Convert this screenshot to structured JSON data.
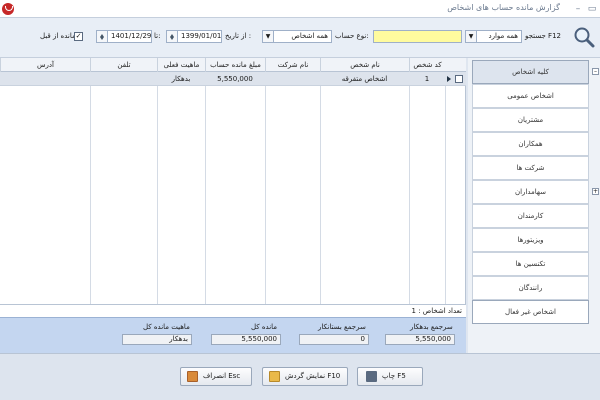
{
  "window": {
    "title": "گزارش مانده حساب های اشخاص",
    "minimize_glyph": "–",
    "restore_glyph": "▭"
  },
  "toolbar": {
    "search_label": "جستجو F12",
    "scope_value": "همه موارد",
    "type_label": "نوع حساب:",
    "type_value": "همه اشخاص",
    "from_label": "از تاریخ :",
    "from_value": "1399/01/01",
    "to_label": "تا:",
    "to_value": "1401/12/29",
    "prev_balance_label": "مانده از قبل",
    "prev_balance_checked": true
  },
  "grid": {
    "columns": [
      "کد شخص",
      "نام شخص",
      "نام شرکت",
      "مبلغ مانده حساب",
      "ماهیت فعلی",
      "تلفن",
      "آدرس"
    ],
    "rows": [
      {
        "code": "1",
        "name": "اشخاص متفرقه",
        "company": "",
        "amount": "5,550,000",
        "nature": "بدهکار",
        "phone": "",
        "address": ""
      }
    ]
  },
  "count": {
    "label": "تعداد اشخاص : 1"
  },
  "summary": {
    "debit_label": "سرجمع بدهکار",
    "debit_value": "5,550,000",
    "credit_label": "سرجمع بستانکار",
    "credit_value": "0",
    "total_label": "مانده کل",
    "total_value": "5,550,000",
    "nature_label": "ماهیت مانده کل",
    "nature_value": "بدهکار"
  },
  "footer": {
    "print_label": "چاپ F5",
    "turnover_label": "نمایش گردش F10",
    "cancel_label": "انصراف Esc"
  },
  "sidebar": {
    "items": [
      "کلیه اشخاص",
      "اشخاص عمومی",
      "مشتریان",
      "همکاران",
      "شرکت ها",
      "سهامداران",
      "کارمندان",
      "ویزیتورها",
      "تکنسین ها",
      "رانندگان",
      "اشخاص غیر فعال"
    ],
    "active_index": 0
  },
  "colors": {
    "accent": "#c62828",
    "summary_bg": "#c4d6f0",
    "yellow": "#fffb9e"
  }
}
